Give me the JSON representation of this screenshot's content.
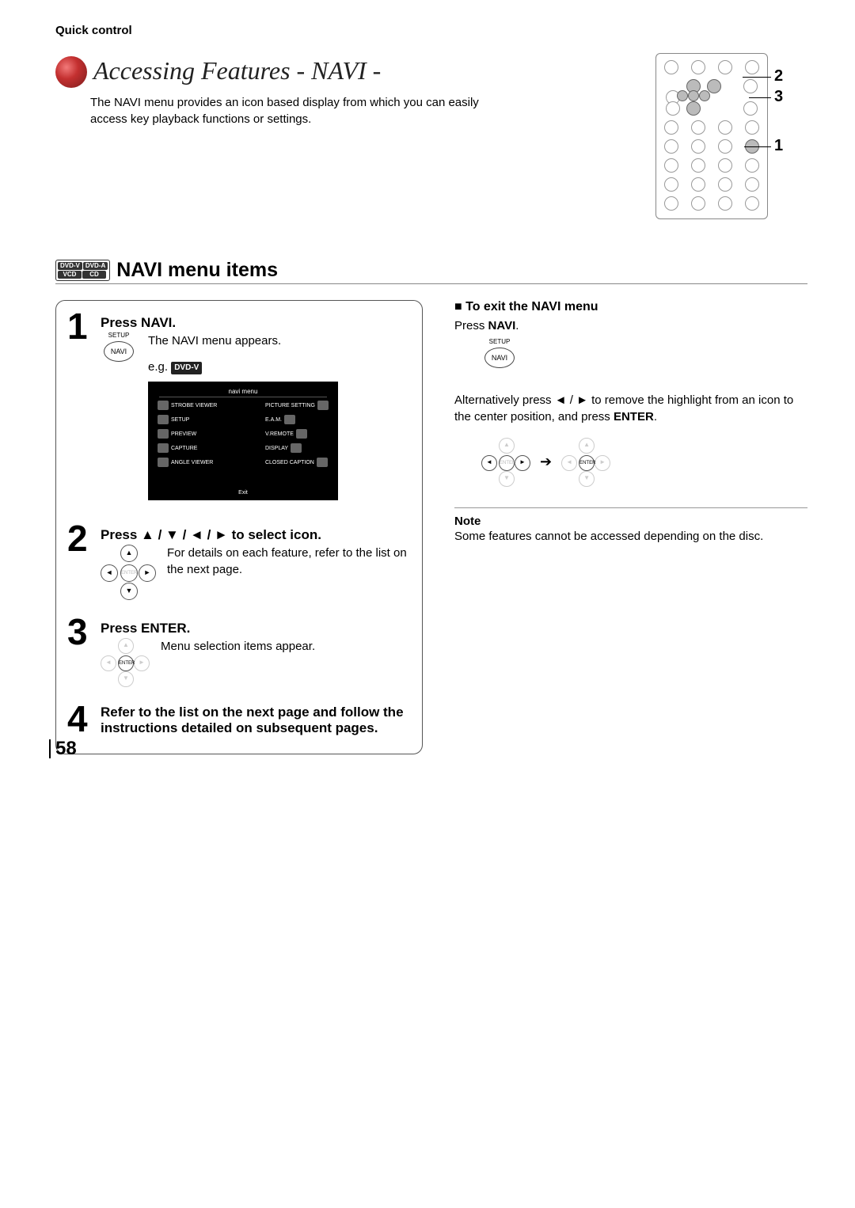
{
  "breadcrumb": "Quick control",
  "title": "Accessing Features - NAVI -",
  "subtitle": "The NAVI menu provides an icon based display from which you can easily access key playback functions or settings.",
  "remote_callouts": {
    "top": "2",
    "mid": "3",
    "row5": "1"
  },
  "section": {
    "badges": [
      "DVD-V",
      "DVD-A",
      "VCD",
      "CD"
    ],
    "title": "NAVI menu items"
  },
  "steps": [
    {
      "num": "1",
      "heading": "Press NAVI.",
      "button_top": "SETUP",
      "button_label": "NAVI",
      "line1": "The NAVI menu appears.",
      "line2_prefix": "e.g.",
      "line2_badge": "DVD-V"
    },
    {
      "num": "2",
      "heading": "Press ▲ / ▼ / ◄ / ► to select icon.",
      "text": "For details on each feature, refer to the list on the next page."
    },
    {
      "num": "3",
      "heading": "Press ENTER.",
      "text": "Menu selection items appear."
    },
    {
      "num": "4",
      "heading": "Refer to the list on the next page and follow the instructions detailed on subsequent pages."
    }
  ],
  "navi_screen": {
    "title": "navi menu",
    "left": [
      "STROBE VIEWER",
      "SETUP",
      "PREVIEW",
      "CAPTURE",
      "ANGLE VIEWER"
    ],
    "right": [
      "PICTURE SETTING",
      "E.A.M.",
      "V.REMOTE",
      "DISPLAY",
      "CLOSED CAPTION"
    ],
    "exit": "Exit"
  },
  "dpad_center_enter": "ENTER",
  "right_col": {
    "exit_heading": "■ To exit the NAVI menu",
    "exit_line": "Press ",
    "exit_bold": "NAVI",
    "exit_button_top": "SETUP",
    "exit_button_label": "NAVI",
    "alt_line_1": "Alternatively press ◄ / ► to remove the highlight from an icon to the center position, and press ",
    "alt_bold": "ENTER",
    "note_heading": "Note",
    "note_text": "Some features cannot be accessed depending on the disc."
  },
  "page_number": "58"
}
